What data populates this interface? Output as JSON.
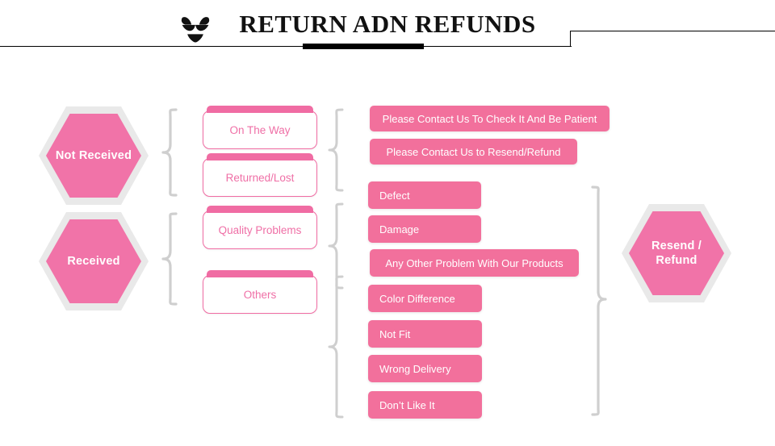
{
  "header": {
    "title": "RETURN ADN REFUNDS",
    "icon": "lingerie-icon"
  },
  "colors": {
    "pink": "#F2709C",
    "pink_hex": "#F173A8",
    "pink_border": "#F06CA3",
    "hex_outline": "#E9E9E9",
    "brace": "#CFCFCF",
    "rule": "#000000",
    "background": "#FFFFFF"
  },
  "stages": {
    "not_received": {
      "label": "Not Received"
    },
    "received": {
      "label": "Received"
    },
    "outcome": {
      "label": "Resend /\nRefund"
    }
  },
  "reasons": {
    "on_the_way": {
      "label": "On The Way"
    },
    "returned_lost": {
      "label": "Returned/Lost"
    },
    "quality_problems": {
      "label": "Quality Problems"
    },
    "others": {
      "label": "Others"
    }
  },
  "actions": {
    "contact_check": {
      "label": "Please Contact Us To Check It And Be Patient"
    },
    "contact_resend": {
      "label": "Please Contact Us to Resend/Refund"
    },
    "defect": {
      "label": "Defect"
    },
    "damage": {
      "label": "Damage"
    },
    "any_other": {
      "label": "Any Other Problem With Our Products"
    },
    "color_difference": {
      "label": "Color Difference"
    },
    "not_fit": {
      "label": "Not Fit"
    },
    "wrong_delivery": {
      "label": "Wrong Delivery"
    },
    "dont_like": {
      "label": "Don’t Like It"
    }
  },
  "connectors": {
    "brace_not_received": "brace-open",
    "brace_received": "brace-open",
    "brace_on_the_way_group": "brace-open",
    "brace_quality_group": "brace-open",
    "brace_others_group": "brace-open",
    "brace_outcome": "brace-close"
  }
}
